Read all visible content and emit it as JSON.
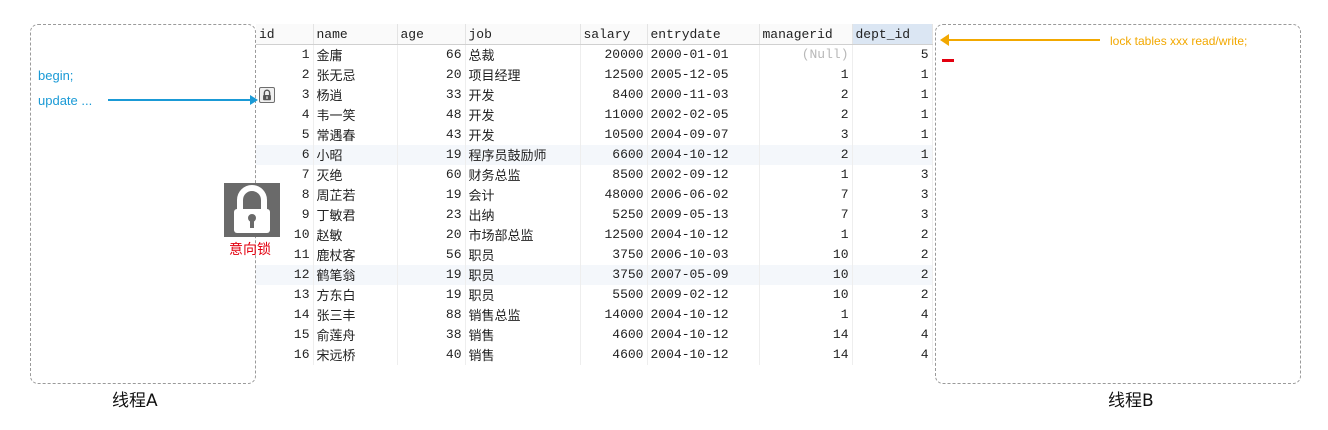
{
  "thread_a": {
    "label": "线程A",
    "notes": {
      "begin": "begin;",
      "update": "update ..."
    }
  },
  "thread_b": {
    "label": "线程B",
    "lock_command": "lock tables xxx read/write;"
  },
  "intent_lock": {
    "label": "意向锁"
  },
  "colors": {
    "blue_note": "#1a9ad6",
    "orange_note": "#f2a800",
    "red": "#e3000f",
    "lock_gray": "#6e6e6e"
  },
  "icons": {
    "row_lock": "padlock-icon",
    "intent_lock": "padlock-icon"
  },
  "table": {
    "columns": [
      "id",
      "name",
      "age",
      "job",
      "salary",
      "entrydate",
      "managerid",
      "dept_id"
    ],
    "sorted_column": "dept_id",
    "rows": [
      [
        "1",
        "金庸",
        "66",
        "总裁",
        "20000",
        "2000-01-01",
        "(Null)",
        "5"
      ],
      [
        "2",
        "张无忌",
        "20",
        "项目经理",
        "12500",
        "2005-12-05",
        "1",
        "1"
      ],
      [
        "3",
        "杨逍",
        "33",
        "开发",
        "8400",
        "2000-11-03",
        "2",
        "1"
      ],
      [
        "4",
        "韦一笑",
        "48",
        "开发",
        "11000",
        "2002-02-05",
        "2",
        "1"
      ],
      [
        "5",
        "常遇春",
        "43",
        "开发",
        "10500",
        "2004-09-07",
        "3",
        "1"
      ],
      [
        "6",
        "小昭",
        "19",
        "程序员鼓励师",
        "6600",
        "2004-10-12",
        "2",
        "1"
      ],
      [
        "7",
        "灭绝",
        "60",
        "财务总监",
        "8500",
        "2002-09-12",
        "1",
        "3"
      ],
      [
        "8",
        "周芷若",
        "19",
        "会计",
        "48000",
        "2006-06-02",
        "7",
        "3"
      ],
      [
        "9",
        "丁敏君",
        "23",
        "出纳",
        "5250",
        "2009-05-13",
        "7",
        "3"
      ],
      [
        "10",
        "赵敏",
        "20",
        "市场部总监",
        "12500",
        "2004-10-12",
        "1",
        "2"
      ],
      [
        "11",
        "鹿杖客",
        "56",
        "职员",
        "3750",
        "2006-10-03",
        "10",
        "2"
      ],
      [
        "12",
        "鹤笔翁",
        "19",
        "职员",
        "3750",
        "2007-05-09",
        "10",
        "2"
      ],
      [
        "13",
        "方东白",
        "19",
        "职员",
        "5500",
        "2009-02-12",
        "10",
        "2"
      ],
      [
        "14",
        "张三丰",
        "88",
        "销售总监",
        "14000",
        "2004-10-12",
        "1",
        "4"
      ],
      [
        "15",
        "俞莲舟",
        "38",
        "销售",
        "4600",
        "2004-10-12",
        "14",
        "4"
      ],
      [
        "16",
        "宋远桥",
        "40",
        "销售",
        "4600",
        "2004-10-12",
        "14",
        "4"
      ]
    ],
    "locked_row_id": "3",
    "highlighted_row_ids": [
      "6",
      "12"
    ]
  }
}
